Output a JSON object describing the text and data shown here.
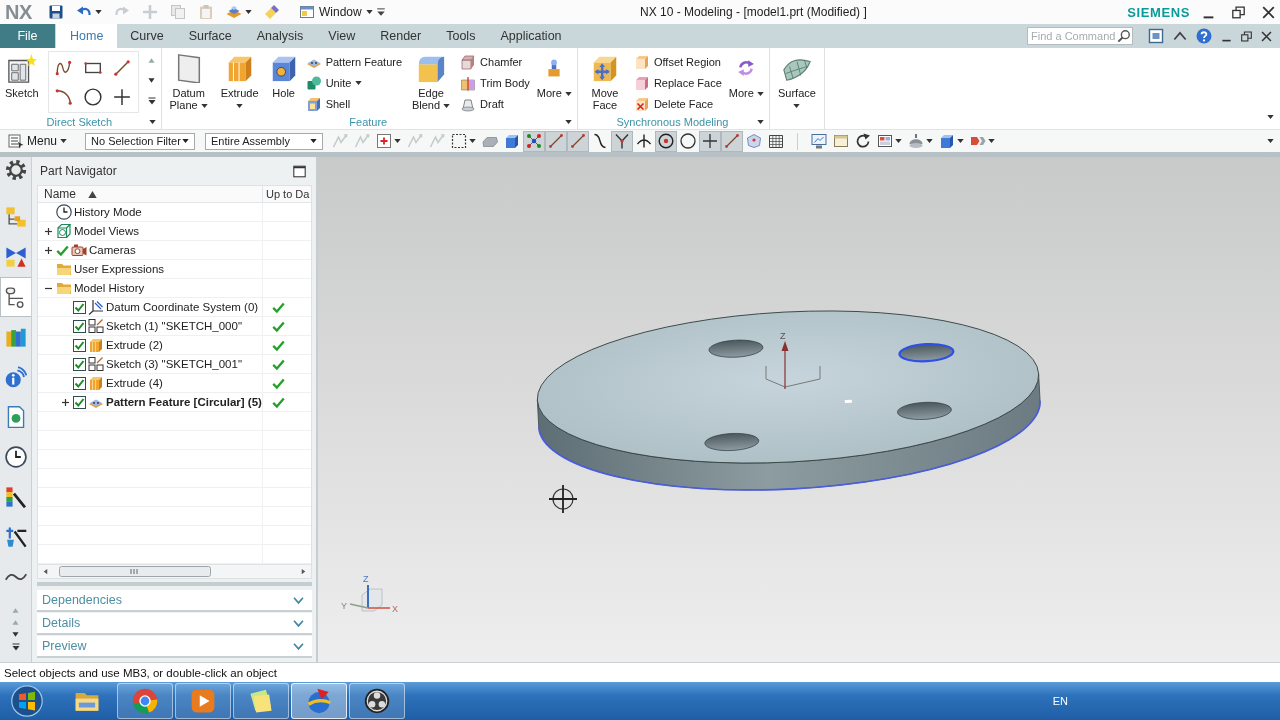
{
  "title_bar": {
    "logo": "NX",
    "quick_access": [
      {
        "kind": "save",
        "disabled": false,
        "dropdown": false
      },
      {
        "kind": "undo",
        "disabled": false,
        "dropdown": true
      },
      {
        "kind": "redo",
        "disabled": true,
        "dropdown": false
      },
      {
        "kind": "plus",
        "disabled": true,
        "dropdown": false
      },
      {
        "kind": "copy",
        "disabled": true,
        "dropdown": false
      },
      {
        "kind": "paste",
        "disabled": true,
        "dropdown": false
      },
      {
        "kind": "layers",
        "disabled": false,
        "dropdown": true
      },
      {
        "kind": "eraser",
        "disabled": false,
        "dropdown": false
      }
    ],
    "window_menu": "Window",
    "title": "NX 10 - Modeling - [model1.prt (Modified) ]",
    "brand": "SIEMENS"
  },
  "file_menu": "File",
  "tabs": [
    {
      "label": "Home",
      "selected": true
    },
    {
      "label": "Curve",
      "selected": false
    },
    {
      "label": "Surface",
      "selected": false
    },
    {
      "label": "Analysis",
      "selected": false
    },
    {
      "label": "View",
      "selected": false
    },
    {
      "label": "Render",
      "selected": false
    },
    {
      "label": "Tools",
      "selected": false
    },
    {
      "label": "Application",
      "selected": false
    }
  ],
  "command_search": {
    "placeholder": "Find a Command"
  },
  "ribbon": {
    "groups": [
      {
        "label": "Direct Sketch",
        "launcher": true,
        "columns": [
          {
            "kind": "large",
            "buttons": [
              {
                "label": "Sketch",
                "kind": "sketch",
                "dropdown": false
              }
            ]
          },
          {
            "kind": "grid",
            "buttons": [
              {
                "kind": "spline"
              },
              {
                "kind": "rectangle"
              },
              {
                "kind": "line"
              },
              {
                "kind": "arc"
              },
              {
                "kind": "circle"
              },
              {
                "kind": "point"
              }
            ]
          }
        ]
      },
      {
        "label": "Feature",
        "launcher": true,
        "columns": [
          {
            "kind": "large",
            "buttons": [
              {
                "label": "Datum Plane",
                "kind": "plane",
                "dropdown": true
              }
            ]
          },
          {
            "kind": "large",
            "buttons": [
              {
                "label": "Extrude",
                "kind": "extrude",
                "dropdown": true
              }
            ]
          },
          {
            "kind": "large",
            "buttons": [
              {
                "label": "Hole",
                "kind": "hole",
                "dropdown": false
              }
            ]
          },
          {
            "kind": "small",
            "buttons": [
              {
                "label": "Pattern Feature",
                "kind": "pattern",
                "dropdown": false
              },
              {
                "label": "Unite",
                "kind": "unite",
                "dropdown": true
              },
              {
                "label": "Shell",
                "kind": "shell",
                "dropdown": false
              }
            ]
          },
          {
            "kind": "large",
            "buttons": [
              {
                "label": "Edge Blend",
                "kind": "blend",
                "dropdown": true
              }
            ]
          },
          {
            "kind": "small",
            "buttons": [
              {
                "label": "Chamfer",
                "kind": "chamfer",
                "dropdown": false
              },
              {
                "label": "Trim Body",
                "kind": "trim",
                "dropdown": false
              },
              {
                "label": "Draft",
                "kind": "draft",
                "dropdown": false
              }
            ]
          },
          {
            "kind": "large",
            "buttons": [
              {
                "label": "More",
                "kind": "shapes",
                "dropdown": true
              }
            ]
          }
        ]
      },
      {
        "label": "Synchronous Modeling",
        "launcher": true,
        "columns": [
          {
            "kind": "large",
            "buttons": [
              {
                "label": "Move Face",
                "kind": "moveface",
                "dropdown": false
              }
            ]
          },
          {
            "kind": "small",
            "buttons": [
              {
                "label": "Offset Region",
                "kind": "offset",
                "dropdown": false
              },
              {
                "label": "Replace Face",
                "kind": "replace",
                "dropdown": false
              },
              {
                "label": "Delete Face",
                "kind": "delete",
                "dropdown": false
              }
            ]
          },
          {
            "kind": "large",
            "buttons": [
              {
                "label": "More",
                "kind": "cycle",
                "dropdown": true
              }
            ]
          }
        ]
      },
      {
        "launcher": false,
        "columns": [
          {
            "kind": "large",
            "buttons": [
              {
                "label": "Surface",
                "kind": "surface",
                "dropdown": true
              }
            ]
          }
        ]
      }
    ]
  },
  "toolbar": {
    "menu": "Menu",
    "selection_filter": "No Selection Filter",
    "assembly_scope": "Entire Assembly",
    "tool_groups": [
      [
        {
          "kind": "arrows",
          "on": false,
          "disabled": true,
          "dropdown": false
        },
        {
          "kind": "arrows",
          "on": false,
          "disabled": true,
          "dropdown": false
        },
        {
          "kind": "snapbox",
          "on": false,
          "disabled": false,
          "dropdown": true
        },
        {
          "kind": "arrows",
          "on": false,
          "disabled": true,
          "dropdown": false
        },
        {
          "kind": "arrows",
          "on": false,
          "disabled": true,
          "dropdown": false
        },
        {
          "kind": "marquee",
          "on": false,
          "disabled": false,
          "dropdown": true
        },
        {
          "kind": "body",
          "on": false,
          "disabled": false,
          "dropdown": false
        },
        {
          "kind": "cube",
          "on": false,
          "disabled": false,
          "dropdown": false
        },
        {
          "kind": "snapgrid",
          "on": true,
          "disabled": false,
          "dropdown": false
        },
        {
          "kind": "line",
          "on": true,
          "disabled": false,
          "dropdown": false
        },
        {
          "kind": "line",
          "on": true,
          "disabled": false,
          "dropdown": false
        },
        {
          "kind": "curve",
          "on": false,
          "disabled": false,
          "dropdown": false
        },
        {
          "kind": "branch",
          "on": true,
          "disabled": false,
          "dropdown": false
        },
        {
          "kind": "perpendicular",
          "on": false,
          "disabled": false,
          "dropdown": false
        },
        {
          "kind": "target",
          "on": true,
          "disabled": false,
          "dropdown": false
        },
        {
          "kind": "circle",
          "on": false,
          "disabled": false,
          "dropdown": false
        },
        {
          "kind": "point",
          "on": true,
          "disabled": false,
          "dropdown": false
        },
        {
          "kind": "line",
          "on": true,
          "disabled": false,
          "dropdown": false
        },
        {
          "kind": "face",
          "on": false,
          "disabled": false,
          "dropdown": false
        },
        {
          "kind": "mesh",
          "on": false,
          "disabled": false,
          "dropdown": false
        }
      ],
      [
        {
          "kind": "view",
          "on": false,
          "disabled": false,
          "dropdown": false
        },
        {
          "kind": "panel",
          "on": false,
          "disabled": false,
          "dropdown": false
        },
        {
          "kind": "rotate",
          "on": false,
          "disabled": false,
          "dropdown": false
        },
        {
          "kind": "layout",
          "on": false,
          "disabled": false,
          "dropdown": true
        },
        {
          "kind": "shading",
          "on": false,
          "disabled": false,
          "dropdown": true
        },
        {
          "kind": "cube",
          "on": false,
          "disabled": false,
          "dropdown": true
        },
        {
          "kind": "arrowpair",
          "on": false,
          "disabled": false,
          "dropdown": true
        }
      ]
    ]
  },
  "resource_bar": [
    {
      "kind": "settings",
      "selected": false
    },
    {
      "kind": "assembly",
      "selected": false
    },
    {
      "kind": "constraints",
      "selected": false
    },
    {
      "kind": "partnav",
      "selected": true
    },
    {
      "kind": "library",
      "selected": false
    },
    {
      "kind": "hd3d",
      "selected": false
    },
    {
      "kind": "document",
      "selected": false
    },
    {
      "kind": "history",
      "selected": false
    },
    {
      "kind": "materials",
      "selected": false
    },
    {
      "kind": "process",
      "selected": false
    },
    {
      "kind": "wave",
      "selected": false
    }
  ],
  "part_navigator": {
    "title": "Part Navigator",
    "columns": [
      {
        "label": "Name",
        "sorted_ascending": true
      },
      {
        "label": "Up to Da"
      }
    ],
    "tree": [
      {
        "label": "History Mode",
        "kind": "clock",
        "ticked": false
      },
      {
        "label": "Model Views",
        "kind": "views",
        "ticked": false,
        "expanded": false
      },
      {
        "label": "Cameras",
        "kind": "camera",
        "ticked": true,
        "expanded": false
      },
      {
        "label": "User Expressions",
        "kind": "folder",
        "ticked": false
      },
      {
        "label": "Model History",
        "kind": "folder",
        "ticked": false,
        "expanded": true,
        "children": [
          {
            "label": "Datum Coordinate System (0)",
            "kind": "datum",
            "checked": true,
            "up_to_date": true,
            "current": false
          },
          {
            "label": "Sketch (1) \"SKETCH_000\"",
            "kind": "sketch",
            "checked": true,
            "up_to_date": true,
            "current": false
          },
          {
            "label": "Extrude (2)",
            "kind": "extrude",
            "checked": true,
            "up_to_date": true,
            "current": false
          },
          {
            "label": "Sketch (3) \"SKETCH_001\"",
            "kind": "sketch",
            "checked": true,
            "up_to_date": true,
            "current": false
          },
          {
            "label": "Extrude (4)",
            "kind": "extrude",
            "checked": true,
            "up_to_date": true,
            "current": false
          },
          {
            "label": "Pattern Feature [Circular] (5)",
            "kind": "pattern",
            "checked": true,
            "up_to_date": true,
            "current": true,
            "expanded": false
          }
        ]
      }
    ],
    "sections": [
      {
        "label": "Dependencies",
        "expanded": false
      },
      {
        "label": "Details",
        "expanded": false
      },
      {
        "label": "Preview",
        "expanded": false
      }
    ]
  },
  "viewport": {
    "datum_label": "Z",
    "triad_labels": {
      "x": "X",
      "y": "Y",
      "z": "Z"
    }
  },
  "status_bar": "Select objects and use MB3, or double-click an object",
  "taskbar": {
    "apps": [
      {
        "kind": "explorer",
        "running": false,
        "selected": false
      },
      {
        "kind": "web",
        "running": true,
        "selected": false
      },
      {
        "kind": "media",
        "running": true,
        "selected": false
      },
      {
        "kind": "notes",
        "running": true,
        "selected": false
      },
      {
        "kind": "cad",
        "running": true,
        "selected": true
      },
      {
        "kind": "recorder",
        "running": true,
        "selected": false
      }
    ],
    "language": "EN"
  }
}
